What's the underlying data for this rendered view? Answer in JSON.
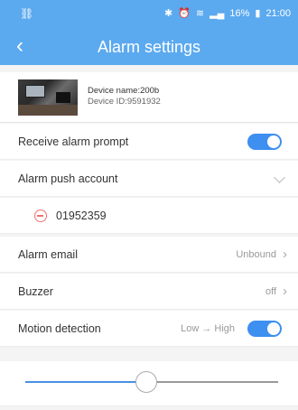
{
  "status_bar": {
    "app_icon": "usb-icon",
    "bluetooth_icon": "bluetooth-icon",
    "alarm_icon": "alarm-icon",
    "wifi_icon": "wifi-icon",
    "signal_icon": "signal-icon",
    "battery_percent": "16%",
    "battery_icon": "battery-icon",
    "time": "21:00"
  },
  "header": {
    "back_icon": "back-icon",
    "title": "Alarm settings"
  },
  "device": {
    "name": "Device name:200b",
    "id": "Device ID:9591932"
  },
  "settings": {
    "receive_alarm_prompt": {
      "label": "Receive alarm prompt",
      "enabled": true
    },
    "alarm_push_account": {
      "label": "Alarm push account",
      "account": "01952359"
    },
    "alarm_email": {
      "label": "Alarm email",
      "value": "Unbound"
    },
    "buzzer": {
      "label": "Buzzer",
      "value": "off"
    },
    "motion_detection": {
      "label": "Motion detection",
      "level": "Low → High",
      "enabled": true
    },
    "sensitivity": {
      "level": 0.48
    }
  },
  "colors": {
    "header_bg": "#5ba9ef",
    "toggle_on": "#3d8ff0",
    "remove_red": "#f07070",
    "slider_active": "#4a90e2"
  }
}
